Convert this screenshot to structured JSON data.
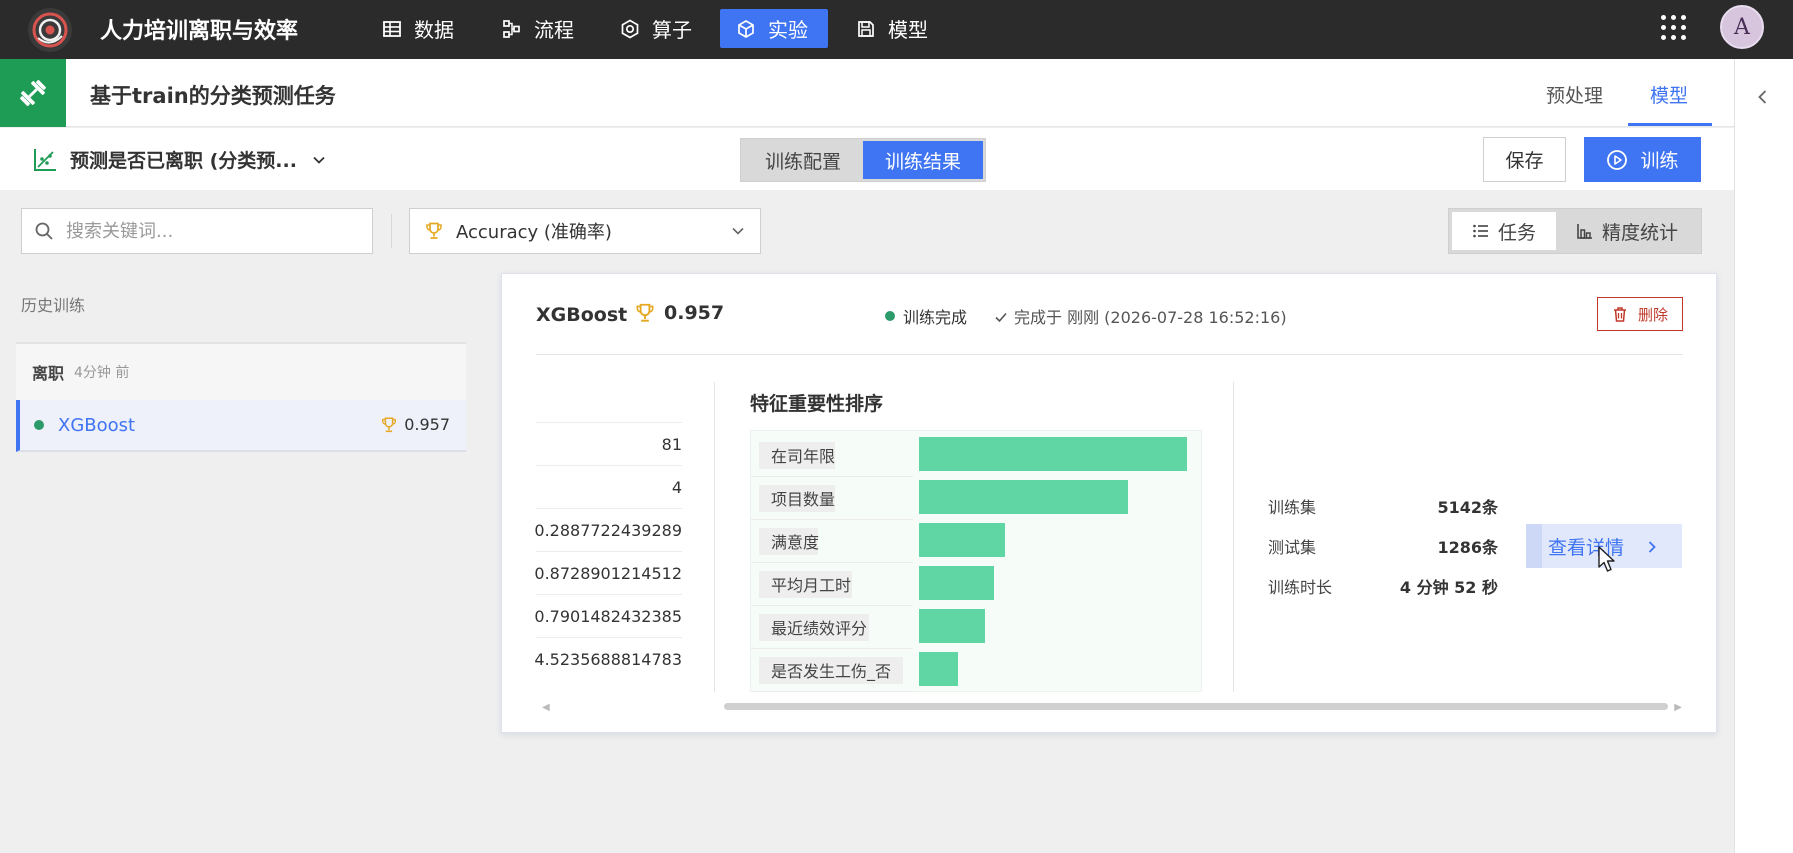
{
  "app": {
    "title": "人力培训离职与效率"
  },
  "nav": {
    "items": [
      {
        "label": "数据",
        "icon": "table-icon"
      },
      {
        "label": "流程",
        "icon": "flow-icon"
      },
      {
        "label": "算子",
        "icon": "operator-icon"
      },
      {
        "label": "实验",
        "icon": "cube-icon",
        "active": true
      },
      {
        "label": "模型",
        "icon": "save-icon"
      }
    ],
    "avatar": "A"
  },
  "header": {
    "task_title": "基于train的分类预测任务",
    "tabs": [
      {
        "label": "预处理"
      },
      {
        "label": "模型",
        "active": true
      }
    ]
  },
  "toolbar": {
    "predict_label": "预测是否已离职 (分类预...",
    "seg": [
      {
        "label": "训练配置"
      },
      {
        "label": "训练结果",
        "active": true
      }
    ],
    "save_label": "保存",
    "train_label": "训练"
  },
  "filters": {
    "search_placeholder": "搜索关键词...",
    "metric_value": "Accuracy (准确率)",
    "view_tabs": [
      {
        "label": "任务",
        "active": true
      },
      {
        "label": "精度统计"
      }
    ]
  },
  "history": {
    "label": "历史训练",
    "group": {
      "name": "离职",
      "time": "4分钟 前"
    },
    "items": [
      {
        "name": "XGBoost",
        "score": "0.957"
      }
    ]
  },
  "card": {
    "model": "XGBoost",
    "score": "0.957",
    "status": "训练完成",
    "done_text": "完成于 刚刚 (2026-07-28 16:52:16)",
    "delete_label": "删除",
    "values": [
      "81",
      "4",
      "0.2887722439289",
      "0.8728901214512",
      "0.7901482432385",
      "4.5235688814783"
    ],
    "feature_importance": {
      "title": "特征重要性排序",
      "features": [
        "在司年限",
        "项目数量",
        "满意度",
        "平均月工时",
        "最近绩效评分",
        "是否发生工伤_否"
      ],
      "importance": [
        1.0,
        0.78,
        0.32,
        0.28,
        0.245,
        0.145
      ],
      "bar_color": "#5fd6a4"
    },
    "stats": [
      {
        "label": "训练集",
        "value": "5142条"
      },
      {
        "label": "测试集",
        "value": "1286条"
      },
      {
        "label": "训练时长",
        "value": "4 分钟 52 秒"
      }
    ],
    "detail_label": "查看详情"
  },
  "colors": {
    "accent": "#3f74f2",
    "success": "#2c9a6a",
    "danger": "#c0392b",
    "topbar": "#2b2b2b",
    "brand_green": "#1e9c56"
  }
}
